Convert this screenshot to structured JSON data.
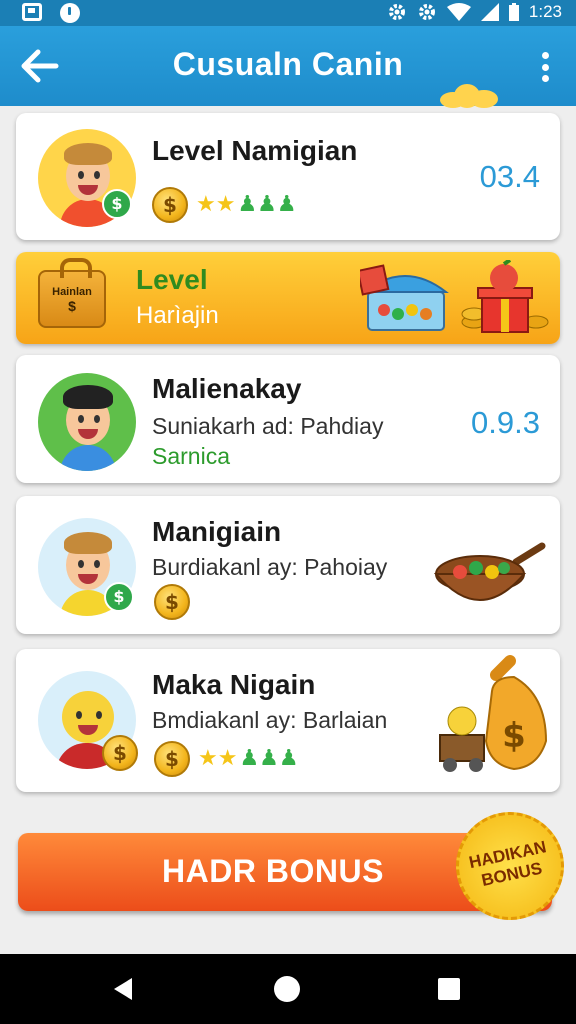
{
  "status_bar": {
    "time": "1:23",
    "icons": [
      "app-icon",
      "clock-icon",
      "settings-icon",
      "settings-icon",
      "wifi-icon",
      "signal-icon",
      "battery-icon"
    ]
  },
  "app_bar": {
    "title": "Cusualn Canin",
    "back_icon": "back-arrow-icon",
    "menu_icon": "more-vert-icon"
  },
  "cards": [
    {
      "name": "Level Namigian",
      "score": "03.4",
      "coin_symbol": "$",
      "stars": "★★",
      "people": "♟♟♟"
    },
    {
      "name": "Malienakay",
      "subtitle": "Suniakarh ad: Pahdiay",
      "subtitle2": "Sarnica",
      "score": "0.9.3"
    },
    {
      "name": "Manigiain",
      "subtitle": "Burdiakanl ay: Pahoiay",
      "coin_symbol": "$"
    },
    {
      "name": "Maka Nigain",
      "subtitle": "Bmdiakanl ay: Barlaian",
      "coin_symbol": "$",
      "stars": "★★",
      "people": "♟♟♟"
    }
  ],
  "banner": {
    "bag_label": "Hainlan",
    "bag_symbol": "$",
    "title": "Level",
    "subtitle": "Harìajin"
  },
  "bonus": {
    "label": "HADR BONUS",
    "seal_line1": "HADIKAN",
    "seal_line2": "BONUS"
  },
  "colors": {
    "app_bar": "#2196d6",
    "accent_score": "#2b9ad6",
    "green_text": "#2c9b2c",
    "banner": "#f7b52a",
    "bonus": "#f06a2a"
  }
}
